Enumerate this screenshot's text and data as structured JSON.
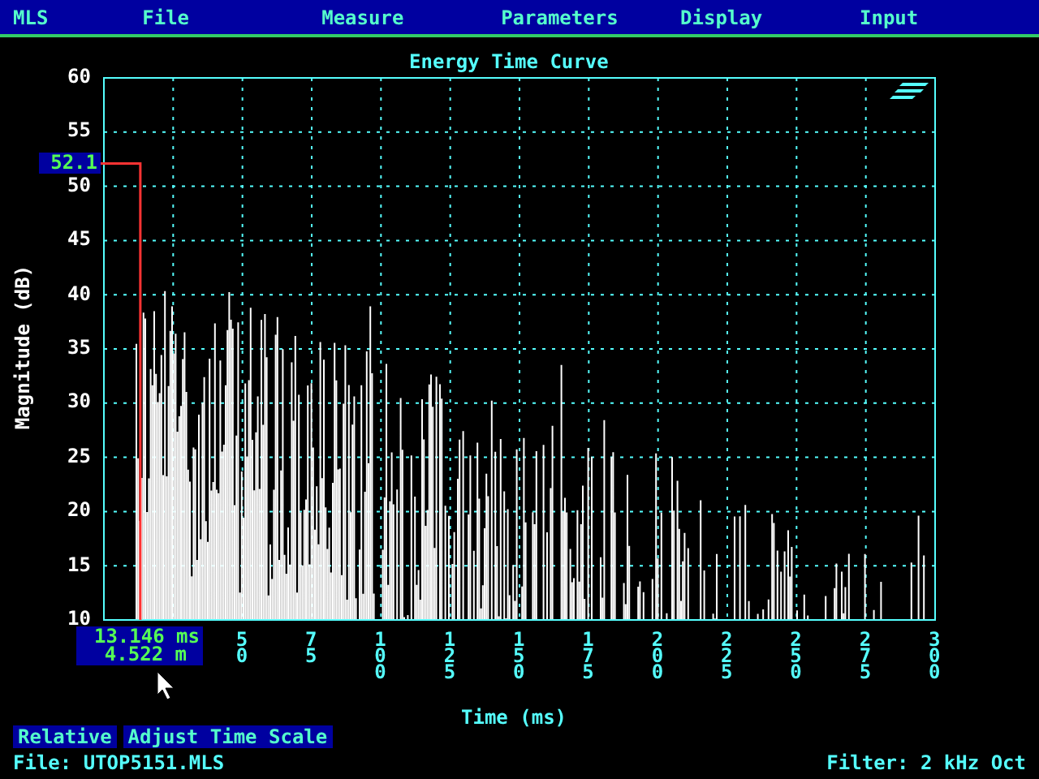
{
  "menu": [
    {
      "label": "MLS"
    },
    {
      "label": "File"
    },
    {
      "label": "Measure"
    },
    {
      "label": "Parameters"
    },
    {
      "label": "Display"
    },
    {
      "label": "Input"
    }
  ],
  "chart": {
    "title": "Energy Time Curve",
    "y_axis_label": "Magnitude (dB)",
    "x_axis_label": "Time (ms)",
    "y_ticks": [
      "60",
      "55",
      "50",
      "45",
      "40",
      "35",
      "30",
      "25",
      "20",
      "15",
      "10"
    ],
    "x_ticks": [
      "50",
      "75",
      "100",
      "125",
      "150",
      "175",
      "200",
      "225",
      "250",
      "275",
      "300"
    ],
    "cursor": {
      "level_readout": "52.1",
      "time": "13.146 ms",
      "distance": "4.522 m"
    }
  },
  "buttons": [
    {
      "label": "Relative"
    },
    {
      "label": "Adjust Time Scale"
    }
  ],
  "status": {
    "file": "File: UTOP5151.MLS",
    "filter": "Filter: 2 kHz Oct"
  }
}
